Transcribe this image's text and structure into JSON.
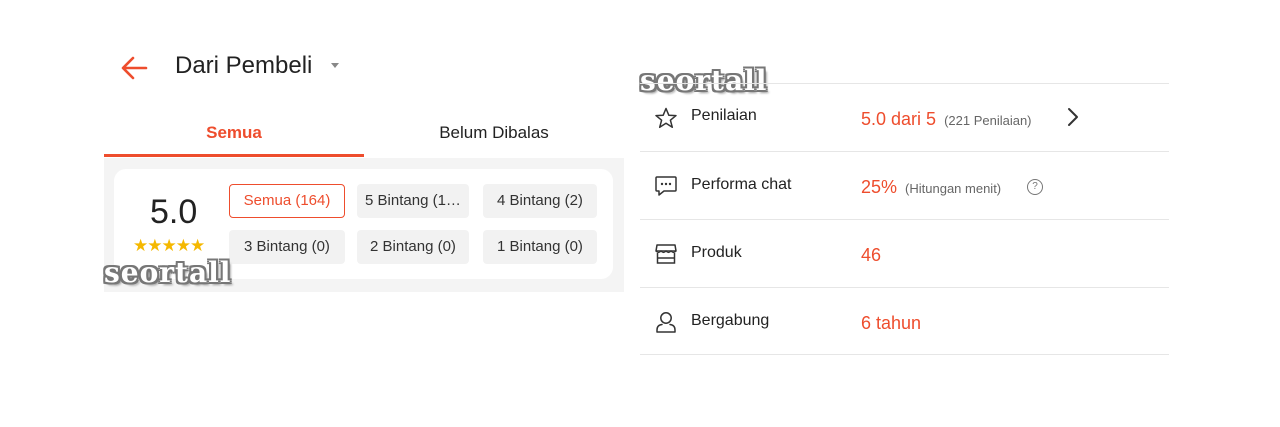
{
  "header": {
    "title": "Dari Pembeli"
  },
  "tabs": [
    {
      "label": "Semua",
      "active": true
    },
    {
      "label": "Belum Dibalas",
      "active": false
    }
  ],
  "rating": {
    "score": "5.0",
    "stars": "★★★★★"
  },
  "filters": [
    {
      "label": "Semua (164)",
      "active": true
    },
    {
      "label": "5 Bintang (1…"
    },
    {
      "label": "4 Bintang (2)"
    },
    {
      "label": "3 Bintang (0)"
    },
    {
      "label": "2 Bintang (0)"
    },
    {
      "label": "1 Bintang (0)"
    }
  ],
  "watermarks": [
    "seortall",
    "seortall"
  ],
  "shop_info": [
    {
      "icon": "star-outline-icon",
      "label": "Penilaian",
      "value": "5.0 dari 5",
      "note": "(221 Penilaian)"
    },
    {
      "icon": "chat-bubble-icon",
      "label": "Performa chat",
      "value": "25%",
      "note": "(Hitungan menit)"
    },
    {
      "icon": "storefront-icon",
      "label": "Produk",
      "value": "46"
    },
    {
      "icon": "person-icon",
      "label": "Bergabung",
      "value": "6 tahun"
    }
  ],
  "colors": {
    "accent": "#ee4d2d",
    "star": "#f5b800",
    "divider": "#e6e6e6"
  }
}
